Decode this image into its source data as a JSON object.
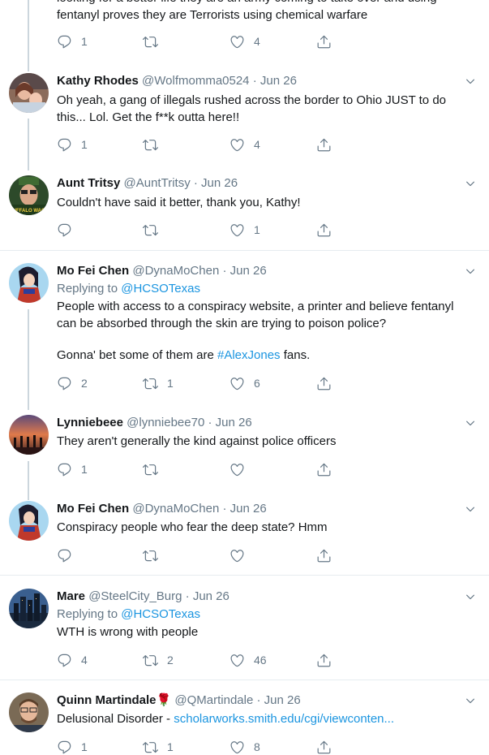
{
  "top_partial": {
    "text_line1": "looking for a better life they are an army coming to take over and using",
    "text_line2": "fentanyl proves they are Terrorists using chemical warfare",
    "reply_count": "1",
    "retweet_count": "",
    "like_count": "4"
  },
  "tweets": [
    {
      "name": "Kathy Rhodes",
      "handle": "@Wolfmomma0524",
      "dot": "·",
      "date": "Jun 26",
      "text": "Oh yeah, a gang of illegals rushed across the border to Ohio JUST to do this... Lol. Get the f**k outta here!!",
      "reply_count": "1",
      "retweet_count": "",
      "like_count": "4"
    },
    {
      "name": "Aunt Tritsy",
      "handle": "@AuntTritsy",
      "dot": "·",
      "date": "Jun 26",
      "text": "Couldn't have said it better, thank you, Kathy!",
      "avatar_text": "BUFFALO WAGS",
      "reply_count": "",
      "retweet_count": "",
      "like_count": "1"
    },
    {
      "name": "Mo Fei Chen",
      "handle": "@DynaMoChen",
      "dot": "·",
      "date": "Jun 26",
      "replying_prefix": "Replying to",
      "replying_to": "@HCSOTexas",
      "text_p1": "People with access to a conspiracy website, a printer and believe fentanyl can be absorbed through the skin are trying to poison police?",
      "text_p2_prefix": "Gonna' bet some of them are",
      "text_p2_hashtag": "#AlexJones",
      "text_p2_suffix": "fans.",
      "reply_count": "2",
      "retweet_count": "1",
      "like_count": "6"
    },
    {
      "name": "Lynniebeee",
      "handle": "@lynniebee70",
      "dot": "·",
      "date": "Jun 26",
      "text": "They aren't generally the kind against police officers",
      "reply_count": "1",
      "retweet_count": "",
      "like_count": ""
    },
    {
      "name": "Mo Fei Chen",
      "handle": "@DynaMoChen",
      "dot": "·",
      "date": "Jun 26",
      "text": "Conspiracy people who fear the deep state? Hmm",
      "reply_count": "",
      "retweet_count": "",
      "like_count": ""
    },
    {
      "name": "Mare",
      "handle": "@SteelCity_Burg",
      "dot": "·",
      "date": "Jun 26",
      "replying_prefix": "Replying to",
      "replying_to": "@HCSOTexas",
      "text": "WTH is wrong with people",
      "reply_count": "4",
      "retweet_count": "2",
      "like_count": "46"
    },
    {
      "name": "Quinn Martindale",
      "name_emoji": "🌹",
      "handle": "@QMartindale",
      "dot": "·",
      "date": "Jun 26",
      "text_prefix": "Delusional Disorder -",
      "text_link": "scholarworks.smith.edu/cgi/viewconten...",
      "reply_count": "1",
      "retweet_count": "1",
      "like_count": "8"
    }
  ],
  "icons": {
    "reply": "reply-icon",
    "retweet": "retweet-icon",
    "like": "heart-icon",
    "share": "share-icon",
    "caret": "chevron-down-icon"
  },
  "colors": {
    "text": "#14171a",
    "secondary": "#657786",
    "link": "#1b95e0",
    "border": "#e6ecf0",
    "thread": "#ccd6dd"
  }
}
